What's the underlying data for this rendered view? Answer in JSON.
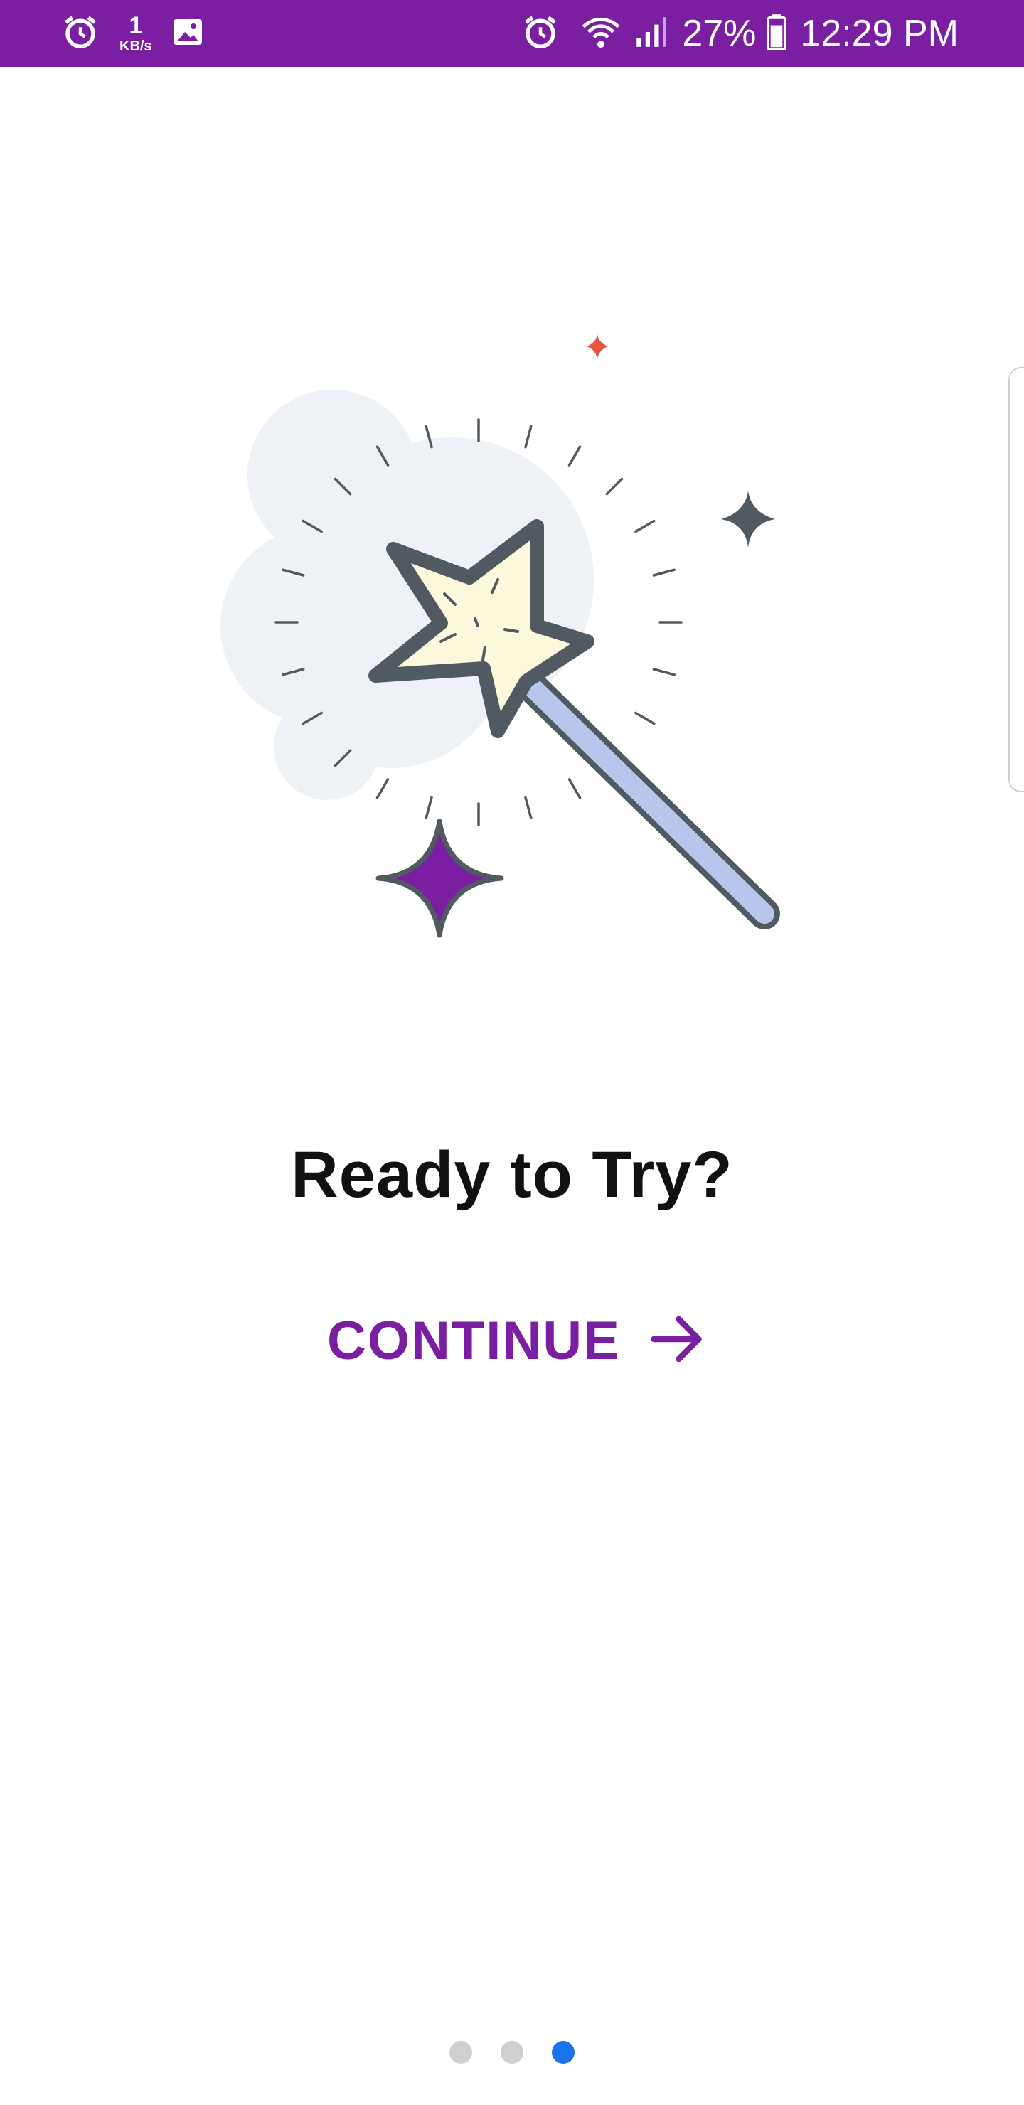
{
  "status_bar": {
    "net_speed_value": "1",
    "net_speed_unit": "KB/s",
    "battery_percent": "27%",
    "time": "12:29 PM",
    "icons": [
      "alarm-icon",
      "image-icon",
      "alarm-icon",
      "wifi-icon",
      "signal-icon",
      "battery-icon"
    ]
  },
  "onboarding": {
    "headline": "Ready to Try?",
    "continue_label": "CONTINUE",
    "pager": {
      "total": 3,
      "current": 3
    }
  },
  "colors": {
    "brand": "#7b1fa2",
    "pager_active": "#1a73e8",
    "pager_inactive": "#cfcfcf"
  }
}
